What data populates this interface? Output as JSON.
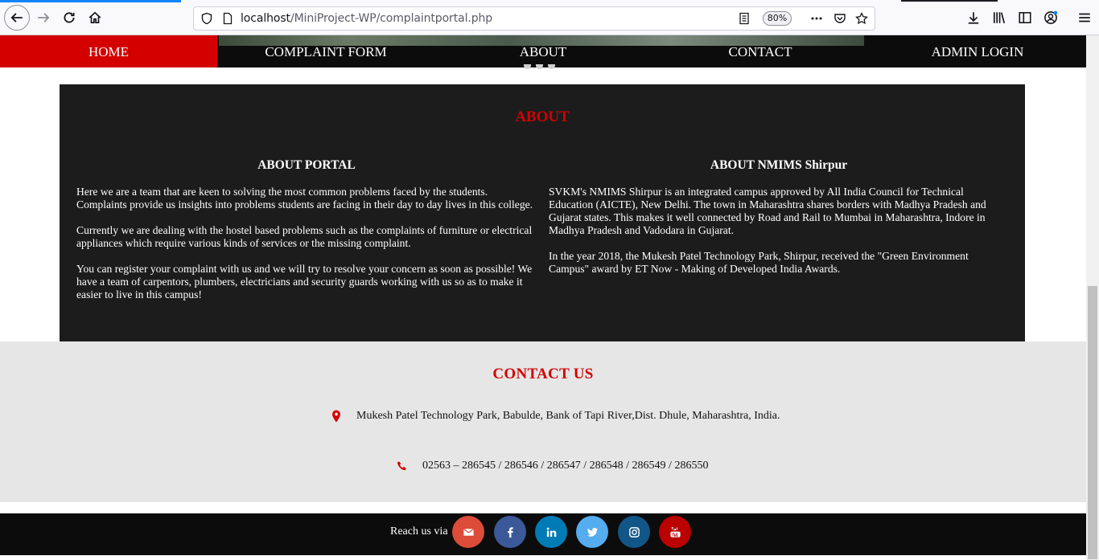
{
  "browser": {
    "url_host": "localhost",
    "url_path": "/MiniProject-WP/complaintportal.php",
    "zoom": "80%"
  },
  "nav": {
    "items": [
      {
        "label": "HOME",
        "active": true
      },
      {
        "label": "COMPLAINT FORM",
        "active": false
      },
      {
        "label": "ABOUT",
        "active": false
      },
      {
        "label": "CONTACT",
        "active": false
      },
      {
        "label": "ADMIN LOGIN",
        "active": false
      }
    ]
  },
  "about": {
    "title": "ABOUT",
    "portal": {
      "heading": "ABOUT PORTAL",
      "paragraphs": [
        "Here we are a team that are keen to solving the most common problems faced by the students. Complaints provide us insights into problems students are facing in their day to day lives in this college.",
        "Currently we are dealing with the hostel based problems such as the complaints of furniture or electrical appliances which require various kinds of services or the missing complaint.",
        "You can register your complaint with us and we will try to resolve your concern as soon as possible! We have a team of carpentors, plumbers, electricians and security guards working with us so as to make it easier to live in this campus!"
      ]
    },
    "nmims": {
      "heading": "ABOUT NMIMS Shirpur",
      "paragraphs": [
        "SVKM's NMIMS Shirpur is an integrated campus approved by All India Council for Technical Education (AICTE), New Delhi. The town in Maharashtra shares borders with Madhya Pradesh and Gujarat states. This makes it well connected by Road and Rail to Mumbai in Maharashtra, Indore in Madhya Pradesh and Vadodara in Gujarat.",
        "In the year 2018, the Mukesh Patel Technology Park, Shirpur, received the \"Green Environment Campus\" award by ET Now - Making of Developed India Awards."
      ]
    }
  },
  "contact": {
    "title": "CONTACT US",
    "address": "Mukesh Patel Technology Park, Babulde, Bank of Tapi River,Dist. Dhule, Maharashtra, India.",
    "phone": "02563 – 286545 / 286546 / 286547 / 286548 / 286549 / 286550"
  },
  "footer": {
    "reach_label": "Reach us via",
    "social": [
      {
        "icon": "envelope-icon",
        "color": "#dd4b39"
      },
      {
        "icon": "facebook-icon",
        "color": "#3b5998"
      },
      {
        "icon": "linkedin-icon",
        "color": "#007bb5"
      },
      {
        "icon": "twitter-icon",
        "color": "#55acee"
      },
      {
        "icon": "instagram-icon",
        "color": "#125688"
      },
      {
        "icon": "youtube-icon",
        "color": "#bb0000"
      }
    ]
  },
  "colors": {
    "accent": "#d40000",
    "nav_bg": "#0c0c0c",
    "about_bg": "#1c1c1c",
    "contact_bg": "#e6e6e6"
  }
}
